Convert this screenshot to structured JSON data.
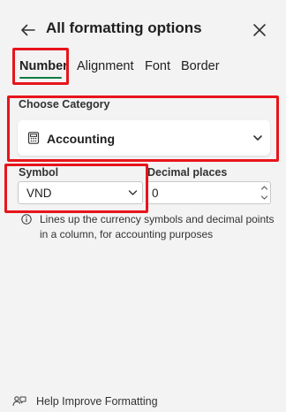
{
  "header": {
    "title": "All formatting options",
    "back_icon": "arrow-left-icon",
    "close_icon": "close-icon"
  },
  "tabs": [
    {
      "label": "Number",
      "active": true
    },
    {
      "label": "Alignment",
      "active": false
    },
    {
      "label": "Font",
      "active": false
    },
    {
      "label": "Border",
      "active": false
    }
  ],
  "category": {
    "label": "Choose Category",
    "value": "Accounting",
    "icon": "calculator-icon"
  },
  "symbol": {
    "label": "Symbol",
    "value": "VND"
  },
  "decimal_places": {
    "label": "Decimal places",
    "value": "0"
  },
  "info": {
    "icon": "info-icon",
    "text": "Lines up the currency symbols and decimal points in a column, for accounting purposes"
  },
  "footer": {
    "label": "Help Improve Formatting",
    "icon": "feedback-icon"
  },
  "colors": {
    "background": "#f3f3f3",
    "accent": "#107c41",
    "highlight": "#e8141b",
    "card": "#ffffff"
  }
}
